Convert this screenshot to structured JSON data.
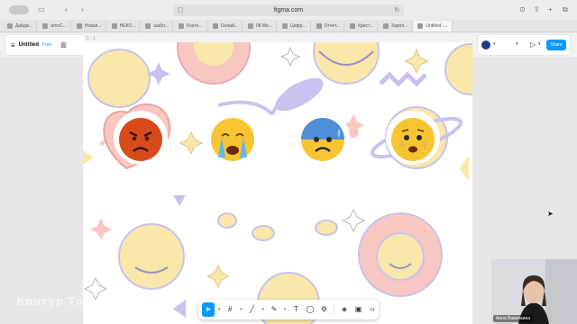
{
  "browser": {
    "url": "figma.com",
    "tabs": [
      "Дайдж...",
      "amoC...",
      "Новая...",
      "НЕКО...",
      "шабл...",
      "Конте...",
      "Онлай...",
      "08 Мо...",
      "Цифр...",
      "Отчёт...",
      "Крест...",
      "Зарпл...",
      "Untitled -..."
    ]
  },
  "figma": {
    "file_title": "Untitled",
    "plan_badge": "Free",
    "share_label": "Share",
    "frame_label": "1 - 1"
  },
  "emojis": [
    "angry-face",
    "crying-face",
    "anxious-face",
    "worried-face"
  ],
  "webcam": {
    "name": "Анна Вавилкина"
  },
  "watermark": "Контур Толк",
  "colors": {
    "accent": "#0d99ff",
    "angry": "#d94a1a",
    "emoji_yellow": "#f7c531",
    "pastel_pink": "#f8c7c2",
    "pastel_lilac": "#c9c1ef",
    "pastel_yellow": "#f8e7a8"
  }
}
